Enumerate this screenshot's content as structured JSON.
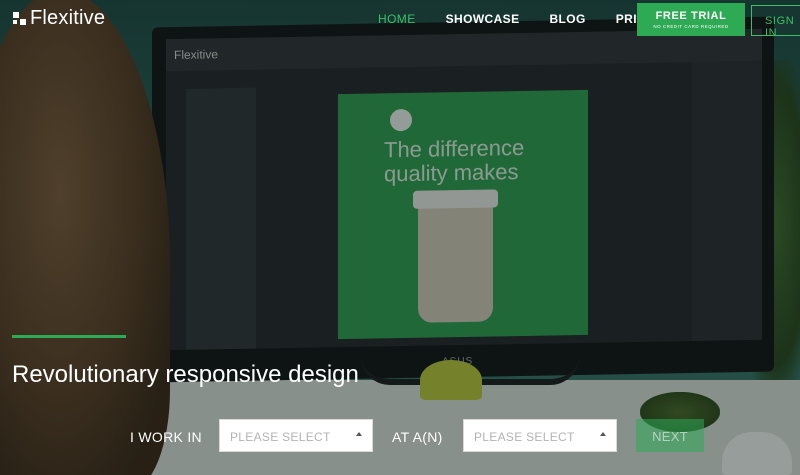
{
  "brand": {
    "name": "Flexitive",
    "logo_icon": "pixel-squares-icon"
  },
  "nav": {
    "links": [
      {
        "label": "HOME",
        "active": true
      },
      {
        "label": "SHOWCASE",
        "active": false
      },
      {
        "label": "BLOG",
        "active": false
      },
      {
        "label": "PRICING",
        "active": false
      }
    ],
    "trial_button": {
      "label": "FREE TRIAL",
      "sublabel": "NO CREDIT CARD REQUIRED"
    },
    "signin_button": {
      "label": "SIGN IN"
    }
  },
  "background": {
    "screen_logo": "Flexitive",
    "canvas_text": "The difference quality makes",
    "monitor_brand": "ASUS"
  },
  "hero": {
    "title": "Revolutionary responsive design",
    "work_label": "I WORK IN",
    "work_select": {
      "value": "PLEASE SELECT"
    },
    "at_label": "AT A(N)",
    "at_select": {
      "value": "PLEASE SELECT"
    },
    "next_button": "NEXT"
  },
  "colors": {
    "accent": "#2eaa55",
    "active_nav": "#3cbf67",
    "text": "#ffffff"
  }
}
